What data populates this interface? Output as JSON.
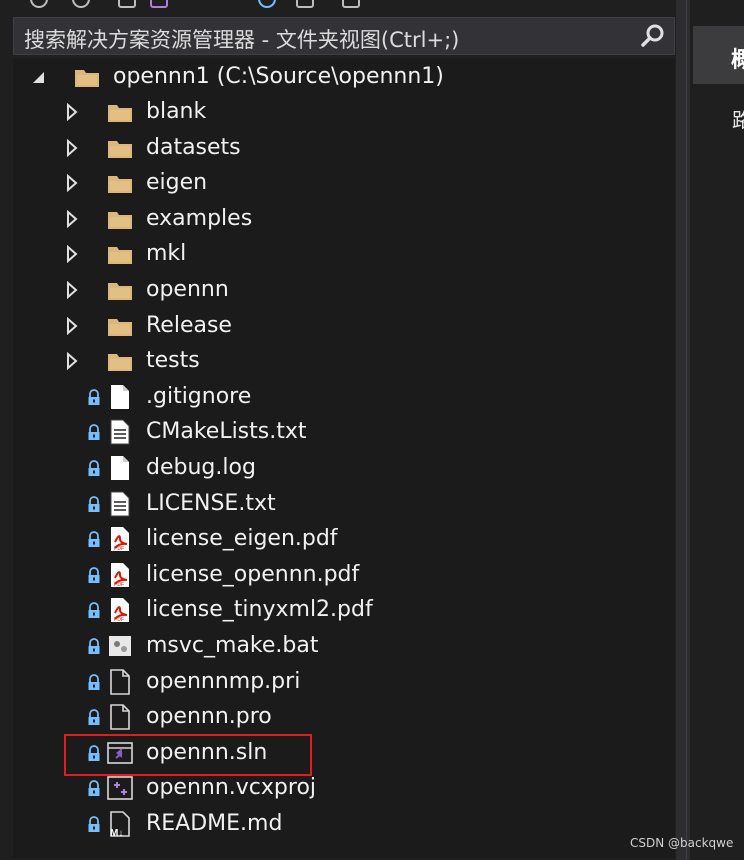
{
  "search": {
    "placeholder": "搜索解决方案资源管理器 - 文件夹视图(Ctrl+;)"
  },
  "root": {
    "label": "opennn1 (C:\\Source\\opennn1)",
    "icon": "folder-icon",
    "expanded": true
  },
  "folders": [
    {
      "label": "blank",
      "icon": "folder-icon"
    },
    {
      "label": "datasets",
      "icon": "folder-icon"
    },
    {
      "label": "eigen",
      "icon": "folder-icon"
    },
    {
      "label": "examples",
      "icon": "folder-icon"
    },
    {
      "label": "mkl",
      "icon": "folder-icon"
    },
    {
      "label": "opennn",
      "icon": "folder-icon"
    },
    {
      "label": "Release",
      "icon": "folder-icon"
    },
    {
      "label": "tests",
      "icon": "folder-icon"
    }
  ],
  "files": [
    {
      "label": ".gitignore",
      "icon": "blank-file-icon",
      "locked": true
    },
    {
      "label": "CMakeLists.txt",
      "icon": "text-file-icon",
      "locked": true
    },
    {
      "label": "debug.log",
      "icon": "blank-file-icon",
      "locked": true
    },
    {
      "label": "LICENSE.txt",
      "icon": "text-file-icon",
      "locked": true
    },
    {
      "label": "license_eigen.pdf",
      "icon": "pdf-file-icon",
      "locked": true
    },
    {
      "label": "license_opennn.pdf",
      "icon": "pdf-file-icon",
      "locked": true
    },
    {
      "label": "license_tinyxml2.pdf",
      "icon": "pdf-file-icon",
      "locked": true
    },
    {
      "label": "msvc_make.bat",
      "icon": "batch-file-icon",
      "locked": true
    },
    {
      "label": "opennnmp.pri",
      "icon": "generic-file-icon",
      "locked": true
    },
    {
      "label": "opennn.pro",
      "icon": "generic-file-icon",
      "locked": true
    },
    {
      "label": "opennn.sln",
      "icon": "solution-file-icon",
      "locked": true,
      "highlighted": true
    },
    {
      "label": "opennn.vcxproj",
      "icon": "vcxproj-file-icon",
      "locked": true
    },
    {
      "label": "README.md",
      "icon": "markdown-file-icon",
      "locked": true
    }
  ],
  "right_pane": {
    "tab_label": "概",
    "text": "路"
  },
  "watermark": "CSDN @backqwe",
  "colors": {
    "background": "#1b1b1c",
    "folder": "#dcb67a",
    "lock": "#75bfff",
    "pdf": "#e51400",
    "highlight": "#e01e22",
    "vs_purple": "#865fc5"
  }
}
